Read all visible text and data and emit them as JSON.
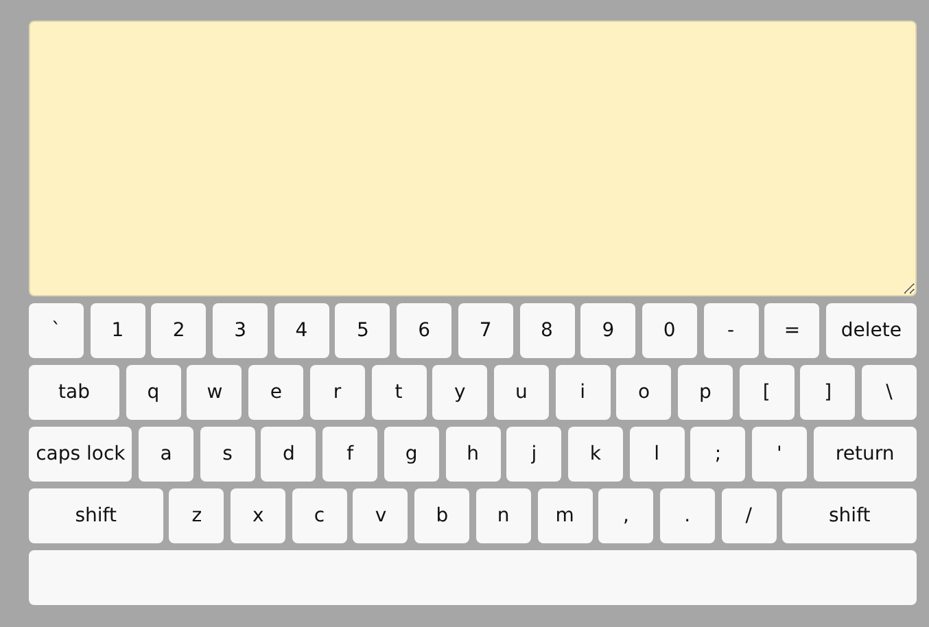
{
  "text_area": {
    "resizable": true
  },
  "keyboard": {
    "rows": [
      {
        "keys": [
          {
            "label": "`",
            "kind": "char"
          },
          {
            "label": "1",
            "kind": "char"
          },
          {
            "label": "2",
            "kind": "char"
          },
          {
            "label": "3",
            "kind": "char"
          },
          {
            "label": "4",
            "kind": "char"
          },
          {
            "label": "5",
            "kind": "char"
          },
          {
            "label": "6",
            "kind": "char"
          },
          {
            "label": "7",
            "kind": "char"
          },
          {
            "label": "8",
            "kind": "char"
          },
          {
            "label": "9",
            "kind": "char"
          },
          {
            "label": "0",
            "kind": "char"
          },
          {
            "label": "-",
            "kind": "char"
          },
          {
            "label": "=",
            "kind": "char"
          },
          {
            "label": "delete",
            "kind": "wide"
          }
        ]
      },
      {
        "keys": [
          {
            "label": "tab",
            "kind": "wide"
          },
          {
            "label": "q",
            "kind": "char"
          },
          {
            "label": "w",
            "kind": "char"
          },
          {
            "label": "e",
            "kind": "char"
          },
          {
            "label": "r",
            "kind": "char"
          },
          {
            "label": "t",
            "kind": "char"
          },
          {
            "label": "y",
            "kind": "char"
          },
          {
            "label": "u",
            "kind": "char"
          },
          {
            "label": "i",
            "kind": "char"
          },
          {
            "label": "o",
            "kind": "char"
          },
          {
            "label": "p",
            "kind": "char"
          },
          {
            "label": "[",
            "kind": "char"
          },
          {
            "label": "]",
            "kind": "char"
          },
          {
            "label": "\\",
            "kind": "char"
          }
        ]
      },
      {
        "keys": [
          {
            "label": "caps lock",
            "kind": "wide"
          },
          {
            "label": "a",
            "kind": "char"
          },
          {
            "label": "s",
            "kind": "char"
          },
          {
            "label": "d",
            "kind": "char"
          },
          {
            "label": "f",
            "kind": "char"
          },
          {
            "label": "g",
            "kind": "char"
          },
          {
            "label": "h",
            "kind": "char"
          },
          {
            "label": "j",
            "kind": "char"
          },
          {
            "label": "k",
            "kind": "char"
          },
          {
            "label": "l",
            "kind": "char"
          },
          {
            "label": ";",
            "kind": "char"
          },
          {
            "label": "'",
            "kind": "char"
          },
          {
            "label": "return",
            "kind": "wide"
          }
        ]
      },
      {
        "keys": [
          {
            "label": "shift",
            "kind": "wide"
          },
          {
            "label": "z",
            "kind": "char"
          },
          {
            "label": "x",
            "kind": "char"
          },
          {
            "label": "c",
            "kind": "char"
          },
          {
            "label": "v",
            "kind": "char"
          },
          {
            "label": "b",
            "kind": "char"
          },
          {
            "label": "n",
            "kind": "char"
          },
          {
            "label": "m",
            "kind": "char"
          },
          {
            "label": ",",
            "kind": "char"
          },
          {
            "label": ".",
            "kind": "char"
          },
          {
            "label": "/",
            "kind": "char"
          },
          {
            "label": "shift",
            "kind": "wide"
          }
        ]
      },
      {
        "keys": [
          {
            "kind": "space"
          }
        ]
      }
    ]
  }
}
